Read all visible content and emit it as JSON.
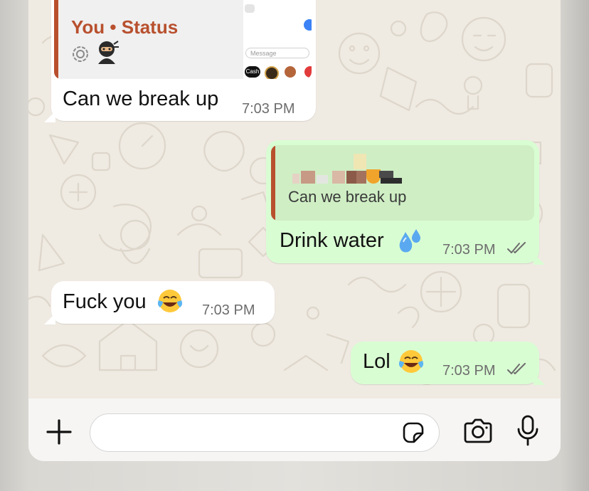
{
  "chat": {
    "messages": [
      {
        "direction": "incoming",
        "reply_to": {
          "author": "You • Status",
          "media": "status thumbnail"
        },
        "text": "Can we break up",
        "time": "7:03 PM"
      },
      {
        "direction": "outgoing",
        "reply_to": {
          "author": "(redacted name)",
          "text": "Can we break up"
        },
        "text": "Drink water",
        "emoji": "sweat-droplets",
        "time": "7:03 PM",
        "read_status": "delivered-double-tick"
      },
      {
        "direction": "incoming",
        "text": "Fuck you",
        "emoji": "tears-of-joy",
        "time": "7:03 PM"
      },
      {
        "direction": "outgoing",
        "text": "Lol",
        "emoji": "tears-of-joy",
        "time": "7:03 PM",
        "read_status": "delivered-double-tick"
      }
    ]
  },
  "status_thumbnail": {
    "input_placeholder": "Message",
    "chip_label": "Cash"
  },
  "composer": {
    "placeholder": "",
    "icons": [
      "plus-icon",
      "sticker-icon",
      "camera-icon",
      "microphone-icon"
    ]
  },
  "colors": {
    "background": "#efeae2",
    "incoming_bubble": "#ffffff",
    "outgoing_bubble": "#d9fdd3",
    "quote_accent": "#b8502e",
    "tick_color": "#6d6d6d"
  }
}
